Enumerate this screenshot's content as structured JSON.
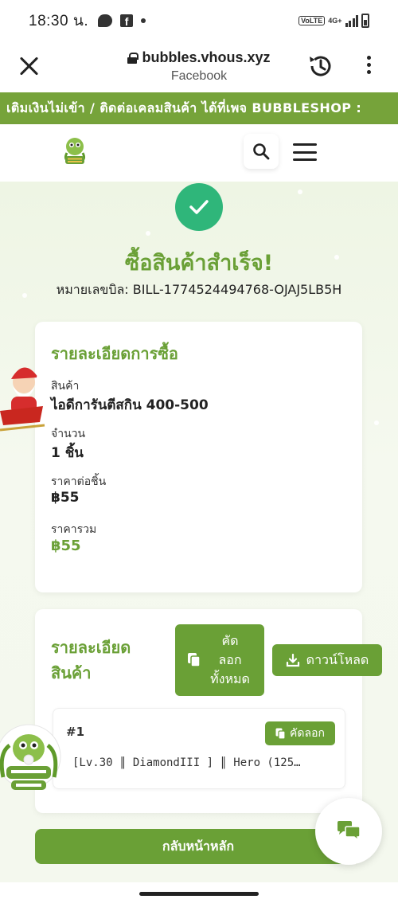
{
  "status_bar": {
    "time": "18:30 น.",
    "volte": "VoLTE",
    "network": "4G+"
  },
  "browser": {
    "url": "bubbles.vhous.xyz",
    "subtitle": "Facebook"
  },
  "marquee": {
    "text": "เติมเงินไม่เข้า / ติดต่อเคลมสินค้า ได้ที่เพจ BUBBLESHOP :"
  },
  "success": {
    "title": "ซื้อสินค้าสำเร็จ!",
    "bill_label": "หมายเลขบิล:",
    "bill_number": "BILL-1774524494768-OJAJ5LB5H"
  },
  "purchase_details": {
    "title": "รายละเอียดการซื้อ",
    "product_label": "สินค้า",
    "product_value": "ไอดีการันตีสกิน 400-500",
    "quantity_label": "จำนวน",
    "quantity_value": "1 ชิ้น",
    "unit_price_label": "ราคาต่อชิ้น",
    "unit_price_value": "฿55",
    "total_label": "ราคารวม",
    "total_value": "฿55"
  },
  "product_details": {
    "title_line1": "รายละเอียด",
    "title_line2": "สินค้า",
    "copy_all_line1": "คัด",
    "copy_all_line2": "ลอก",
    "copy_all_line3": "ทั้งหมด",
    "download_label": "ดาวน์โหลด",
    "items": [
      {
        "number": "#1",
        "copy_label": "คัดลอก",
        "text": "[Lv.30 ║ DiamondIII ] ║ Hero (125…"
      }
    ]
  },
  "home_button": "กลับหน้าหลัก",
  "colors": {
    "brand_green": "#6aa036",
    "success_green": "#2fb67a",
    "marquee_green": "#76a33a"
  }
}
